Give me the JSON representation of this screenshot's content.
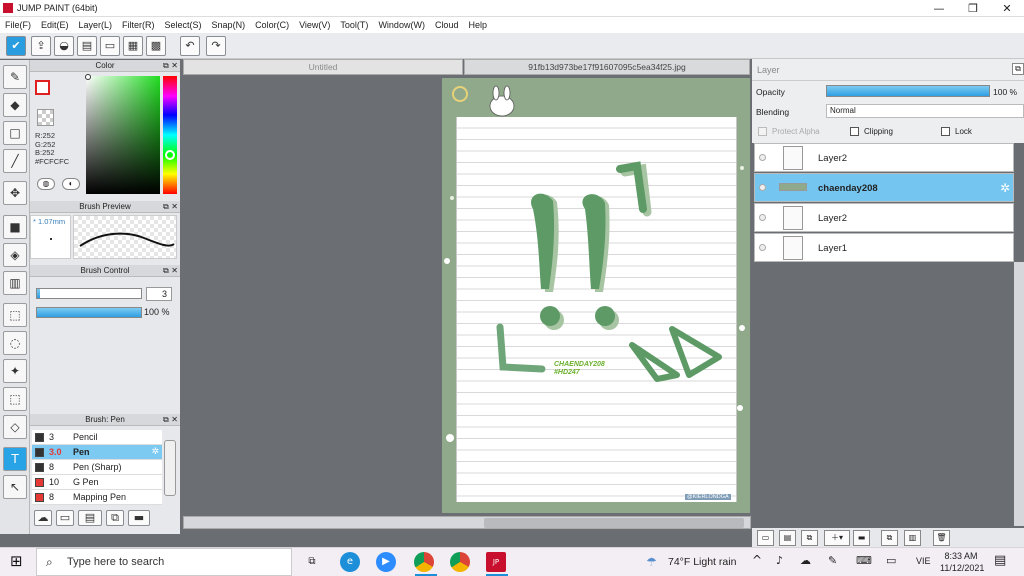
{
  "window": {
    "title": "JUMP PAINT (64bit)",
    "minimize": "—",
    "restore": "❐",
    "close": "✕"
  },
  "menu": [
    "File(F)",
    "Edit(E)",
    "Layer(L)",
    "Filter(R)",
    "Select(S)",
    "Snap(N)",
    "Color(C)",
    "View(V)",
    "Tool(T)",
    "Window(W)",
    "Cloud",
    "Help"
  ],
  "color_panel": {
    "title": "Color",
    "r": "R:252",
    "g": "G:252",
    "b": "B:252",
    "hex": "#FCFCFC",
    "current_color": "#fcfcfc",
    "hue_color": "#22dd22"
  },
  "brush_preview": {
    "title": "Brush Preview",
    "size": "* 1.07mm"
  },
  "brush_control": {
    "title": "Brush Control",
    "size_value": "3",
    "opacity_value": "100 %",
    "size_fraction": 0.03,
    "opacity_fraction": 1.0
  },
  "brush_list": {
    "title": "Brush: Pen",
    "items": [
      {
        "size": "3",
        "name": "Pencil",
        "color": "#333333"
      },
      {
        "size": "3.0",
        "name": "Pen",
        "color": "#333333"
      },
      {
        "size": "8",
        "name": "Pen (Sharp)",
        "color": "#333333"
      },
      {
        "size": "10",
        "name": "G Pen",
        "color": "#e53935"
      },
      {
        "size": "8",
        "name": "Mapping Pen",
        "color": "#e53935"
      }
    ]
  },
  "tabs": [
    {
      "label": "Untitled"
    },
    {
      "label": "91fb13d973be17f91607095c5ea34f25.jpg"
    }
  ],
  "artwork": {
    "caption_line1": "CHAENDAY208",
    "caption_line2": "#HD247",
    "watermark": "@KIERLONDGA"
  },
  "layer_panel": {
    "title": "Layer",
    "opacity_label": "Opacity",
    "opacity_value": "100 %",
    "opacity_fraction": 1.0,
    "blending_label": "Blending",
    "blending_value": "Normal",
    "protect_alpha": "Protect Alpha",
    "clipping": "Clipping",
    "lock": "Lock",
    "layers": [
      {
        "name": "Layer2",
        "selected": false
      },
      {
        "name": "chaenday208",
        "selected": true
      },
      {
        "name": "Layer2",
        "selected": false
      },
      {
        "name": "Layer1",
        "selected": false
      }
    ]
  },
  "taskbar": {
    "search_placeholder": "Type here to search",
    "weather": "74°F  Light rain",
    "lang": "VIE",
    "time": "8:33 AM",
    "date": "11/12/2021"
  },
  "colors": {
    "accent": "#27a3e6",
    "selected_row": "#74c6f1",
    "canvas_bg": "#8fa98a",
    "ink": "#5a9468"
  }
}
